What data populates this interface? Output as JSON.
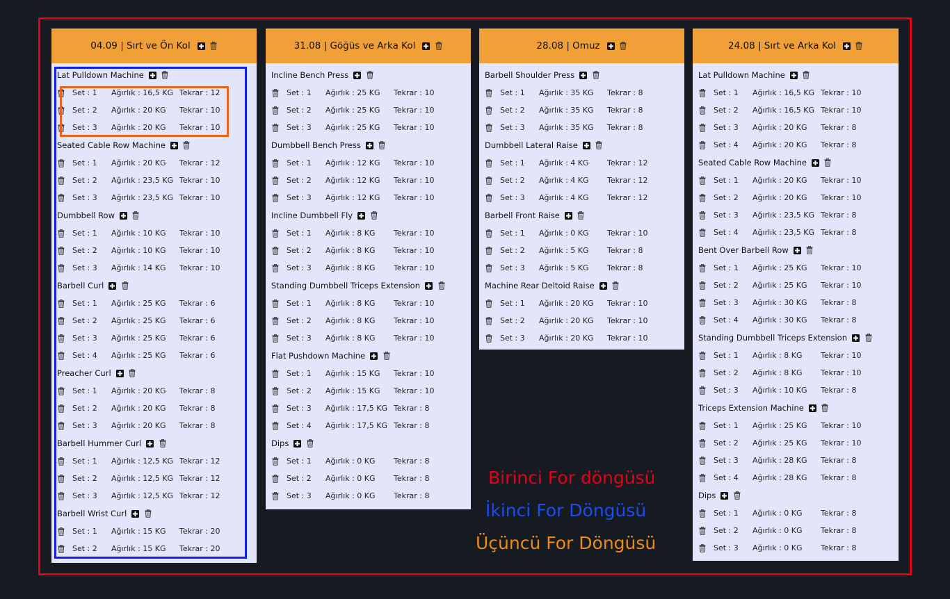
{
  "labels": {
    "set": "Set",
    "weight": "Ağırlık",
    "reps": "Tekrar",
    "unit": "KG"
  },
  "workouts": [
    {
      "date": "04.09",
      "title": "04.09 | Sırt ve Ön Kol",
      "exercises": [
        {
          "name": "Lat Pulldown Machine",
          "sets": [
            {
              "set": "Set : 1",
              "weight": "Ağırlık : 16,5 KG",
              "reps": "Tekrar : 12"
            },
            {
              "set": "Set : 2",
              "weight": "Ağırlık : 20 KG",
              "reps": "Tekrar : 10"
            },
            {
              "set": "Set : 3",
              "weight": "Ağırlık : 20 KG",
              "reps": "Tekrar : 10"
            }
          ]
        },
        {
          "name": "Seated Cable Row Machine",
          "sets": [
            {
              "set": "Set : 1",
              "weight": "Ağırlık : 20 KG",
              "reps": "Tekrar : 12"
            },
            {
              "set": "Set : 2",
              "weight": "Ağırlık : 23,5 KG",
              "reps": "Tekrar : 10"
            },
            {
              "set": "Set : 3",
              "weight": "Ağırlık : 23,5 KG",
              "reps": "Tekrar : 10"
            }
          ]
        },
        {
          "name": "Dumbbell Row",
          "sets": [
            {
              "set": "Set : 1",
              "weight": "Ağırlık : 10 KG",
              "reps": "Tekrar : 10"
            },
            {
              "set": "Set : 2",
              "weight": "Ağırlık : 10 KG",
              "reps": "Tekrar : 10"
            },
            {
              "set": "Set : 3",
              "weight": "Ağırlık : 14 KG",
              "reps": "Tekrar : 10"
            }
          ]
        },
        {
          "name": "Barbell Curl",
          "sets": [
            {
              "set": "Set : 1",
              "weight": "Ağırlık : 25 KG",
              "reps": "Tekrar : 6"
            },
            {
              "set": "Set : 2",
              "weight": "Ağırlık : 25 KG",
              "reps": "Tekrar : 6"
            },
            {
              "set": "Set : 3",
              "weight": "Ağırlık : 25 KG",
              "reps": "Tekrar : 6"
            },
            {
              "set": "Set : 4",
              "weight": "Ağırlık : 25 KG",
              "reps": "Tekrar : 6"
            }
          ]
        },
        {
          "name": "Preacher Curl",
          "sets": [
            {
              "set": "Set : 1",
              "weight": "Ağırlık : 20 KG",
              "reps": "Tekrar : 8"
            },
            {
              "set": "Set : 2",
              "weight": "Ağırlık : 20 KG",
              "reps": "Tekrar : 8"
            },
            {
              "set": "Set : 3",
              "weight": "Ağırlık : 20 KG",
              "reps": "Tekrar : 8"
            }
          ]
        },
        {
          "name": "Barbell Hummer Curl",
          "sets": [
            {
              "set": "Set : 1",
              "weight": "Ağırlık : 12,5 KG",
              "reps": "Tekrar : 12"
            },
            {
              "set": "Set : 2",
              "weight": "Ağırlık : 12,5 KG",
              "reps": "Tekrar : 12"
            },
            {
              "set": "Set : 3",
              "weight": "Ağırlık : 12,5 KG",
              "reps": "Tekrar : 12"
            }
          ]
        },
        {
          "name": "Barbell Wrist Curl",
          "sets": [
            {
              "set": "Set : 1",
              "weight": "Ağırlık : 15 KG",
              "reps": "Tekrar : 20"
            },
            {
              "set": "Set : 2",
              "weight": "Ağırlık : 15 KG",
              "reps": "Tekrar : 20"
            }
          ]
        }
      ]
    },
    {
      "date": "31.08",
      "title": "31.08 | Göğüs ve Arka Kol",
      "exercises": [
        {
          "name": "Incline Bench Press",
          "sets": [
            {
              "set": "Set : 1",
              "weight": "Ağırlık : 25 KG",
              "reps": "Tekrar : 10"
            },
            {
              "set": "Set : 2",
              "weight": "Ağırlık : 25 KG",
              "reps": "Tekrar : 10"
            },
            {
              "set": "Set : 3",
              "weight": "Ağırlık : 25 KG",
              "reps": "Tekrar : 10"
            }
          ]
        },
        {
          "name": "Dumbbell Bench Press",
          "sets": [
            {
              "set": "Set : 1",
              "weight": "Ağırlık : 12 KG",
              "reps": "Tekrar : 10"
            },
            {
              "set": "Set : 2",
              "weight": "Ağırlık : 12 KG",
              "reps": "Tekrar : 10"
            },
            {
              "set": "Set : 3",
              "weight": "Ağırlık : 12 KG",
              "reps": "Tekrar : 10"
            }
          ]
        },
        {
          "name": "Incline Dumbbell Fly",
          "sets": [
            {
              "set": "Set : 1",
              "weight": "Ağırlık : 8 KG",
              "reps": "Tekrar : 10"
            },
            {
              "set": "Set : 2",
              "weight": "Ağırlık : 8 KG",
              "reps": "Tekrar : 10"
            },
            {
              "set": "Set : 3",
              "weight": "Ağırlık : 8 KG",
              "reps": "Tekrar : 10"
            }
          ]
        },
        {
          "name": "Standing Dumbbell Triceps Extension",
          "sets": [
            {
              "set": "Set : 1",
              "weight": "Ağırlık : 8 KG",
              "reps": "Tekrar : 10"
            },
            {
              "set": "Set : 2",
              "weight": "Ağırlık : 8 KG",
              "reps": "Tekrar : 10"
            },
            {
              "set": "Set : 3",
              "weight": "Ağırlık : 8 KG",
              "reps": "Tekrar : 10"
            }
          ]
        },
        {
          "name": "Flat Pushdown Machine",
          "sets": [
            {
              "set": "Set : 1",
              "weight": "Ağırlık : 15 KG",
              "reps": "Tekrar : 10"
            },
            {
              "set": "Set : 2",
              "weight": "Ağırlık : 15 KG",
              "reps": "Tekrar : 10"
            },
            {
              "set": "Set : 3",
              "weight": "Ağırlık : 17,5 KG",
              "reps": "Tekrar : 8"
            },
            {
              "set": "Set : 4",
              "weight": "Ağırlık : 17,5 KG",
              "reps": "Tekrar : 8"
            }
          ]
        },
        {
          "name": "Dips",
          "sets": [
            {
              "set": "Set : 1",
              "weight": "Ağırlık : 0 KG",
              "reps": "Tekrar : 8"
            },
            {
              "set": "Set : 2",
              "weight": "Ağırlık : 0 KG",
              "reps": "Tekrar : 8"
            },
            {
              "set": "Set : 3",
              "weight": "Ağırlık : 0 KG",
              "reps": "Tekrar : 8"
            }
          ]
        }
      ]
    },
    {
      "date": "28.08",
      "title": "28.08 | Omuz",
      "exercises": [
        {
          "name": "Barbell Shoulder Press",
          "sets": [
            {
              "set": "Set : 1",
              "weight": "Ağırlık : 35 KG",
              "reps": "Tekrar : 8"
            },
            {
              "set": "Set : 2",
              "weight": "Ağırlık : 35 KG",
              "reps": "Tekrar : 8"
            },
            {
              "set": "Set : 3",
              "weight": "Ağırlık : 35 KG",
              "reps": "Tekrar : 8"
            }
          ]
        },
        {
          "name": "Dumbbell Lateral Raise",
          "sets": [
            {
              "set": "Set : 1",
              "weight": "Ağırlık : 4 KG",
              "reps": "Tekrar : 12"
            },
            {
              "set": "Set : 2",
              "weight": "Ağırlık : 4 KG",
              "reps": "Tekrar : 12"
            },
            {
              "set": "Set : 3",
              "weight": "Ağırlık : 4 KG",
              "reps": "Tekrar : 12"
            }
          ]
        },
        {
          "name": "Barbell Front Raise",
          "sets": [
            {
              "set": "Set : 1",
              "weight": "Ağırlık : 0 KG",
              "reps": "Tekrar : 10"
            },
            {
              "set": "Set : 2",
              "weight": "Ağırlık : 5 KG",
              "reps": "Tekrar : 8"
            },
            {
              "set": "Set : 3",
              "weight": "Ağırlık : 5 KG",
              "reps": "Tekrar : 8"
            }
          ]
        },
        {
          "name": "Machine Rear Deltoid Raise",
          "sets": [
            {
              "set": "Set : 1",
              "weight": "Ağırlık : 20 KG",
              "reps": "Tekrar : 10"
            },
            {
              "set": "Set : 2",
              "weight": "Ağırlık : 20 KG",
              "reps": "Tekrar : 10"
            },
            {
              "set": "Set : 3",
              "weight": "Ağırlık : 20 KG",
              "reps": "Tekrar : 10"
            }
          ]
        }
      ]
    },
    {
      "date": "24.08",
      "title": "24.08 | Sırt ve Arka Kol",
      "exercises": [
        {
          "name": "Lat Pulldown Machine",
          "sets": [
            {
              "set": "Set : 1",
              "weight": "Ağırlık : 16,5 KG",
              "reps": "Tekrar : 10"
            },
            {
              "set": "Set : 2",
              "weight": "Ağırlık : 16,5 KG",
              "reps": "Tekrar : 10"
            },
            {
              "set": "Set : 3",
              "weight": "Ağırlık : 20 KG",
              "reps": "Tekrar : 8"
            },
            {
              "set": "Set : 4",
              "weight": "Ağırlık : 20 KG",
              "reps": "Tekrar : 8"
            }
          ]
        },
        {
          "name": "Seated Cable Row Machine",
          "sets": [
            {
              "set": "Set : 1",
              "weight": "Ağırlık : 20 KG",
              "reps": "Tekrar : 10"
            },
            {
              "set": "Set : 2",
              "weight": "Ağırlık : 20 KG",
              "reps": "Tekrar : 10"
            },
            {
              "set": "Set : 3",
              "weight": "Ağırlık : 23,5 KG",
              "reps": "Tekrar : 8"
            },
            {
              "set": "Set : 4",
              "weight": "Ağırlık : 23,5 KG",
              "reps": "Tekrar : 8"
            }
          ]
        },
        {
          "name": "Bent Over Barbell Row",
          "sets": [
            {
              "set": "Set : 1",
              "weight": "Ağırlık : 25 KG",
              "reps": "Tekrar : 10"
            },
            {
              "set": "Set : 2",
              "weight": "Ağırlık : 25 KG",
              "reps": "Tekrar : 10"
            },
            {
              "set": "Set : 3",
              "weight": "Ağırlık : 30 KG",
              "reps": "Tekrar : 8"
            },
            {
              "set": "Set : 4",
              "weight": "Ağırlık : 30 KG",
              "reps": "Tekrar : 8"
            }
          ]
        },
        {
          "name": "Standing Dumbbell Triceps Extension",
          "sets": [
            {
              "set": "Set : 1",
              "weight": "Ağırlık : 8 KG",
              "reps": "Tekrar : 10"
            },
            {
              "set": "Set : 2",
              "weight": "Ağırlık : 8 KG",
              "reps": "Tekrar : 10"
            },
            {
              "set": "Set : 3",
              "weight": "Ağırlık : 10 KG",
              "reps": "Tekrar : 8"
            }
          ]
        },
        {
          "name": "Triceps Extension Machine",
          "sets": [
            {
              "set": "Set : 1",
              "weight": "Ağırlık : 25 KG",
              "reps": "Tekrar : 10"
            },
            {
              "set": "Set : 2",
              "weight": "Ağırlık : 25 KG",
              "reps": "Tekrar : 10"
            },
            {
              "set": "Set : 3",
              "weight": "Ağırlık : 28 KG",
              "reps": "Tekrar : 8"
            },
            {
              "set": "Set : 4",
              "weight": "Ağırlık : 28 KG",
              "reps": "Tekrar : 8"
            }
          ]
        },
        {
          "name": "Dips",
          "sets": [
            {
              "set": "Set : 1",
              "weight": "Ağırlık : 0 KG",
              "reps": "Tekrar : 8"
            },
            {
              "set": "Set : 2",
              "weight": "Ağırlık : 0 KG",
              "reps": "Tekrar : 8"
            },
            {
              "set": "Set : 3",
              "weight": "Ağırlık : 0 KG",
              "reps": "Tekrar : 8"
            }
          ]
        }
      ]
    }
  ],
  "annotations": {
    "legend_red": "Birinci For döngüsü",
    "legend_blue": "İkinci For Döngüsü",
    "legend_orange": "Üçüncü For Döngüsü"
  },
  "colors": {
    "background": "#161b22",
    "header": "#f0a036",
    "card": "#e3e6fb",
    "red": "#e3001b",
    "blue": "#1020e6",
    "orange": "#e8641a"
  },
  "icons": {
    "add": "plus-square-icon",
    "delete": "trash-icon"
  }
}
